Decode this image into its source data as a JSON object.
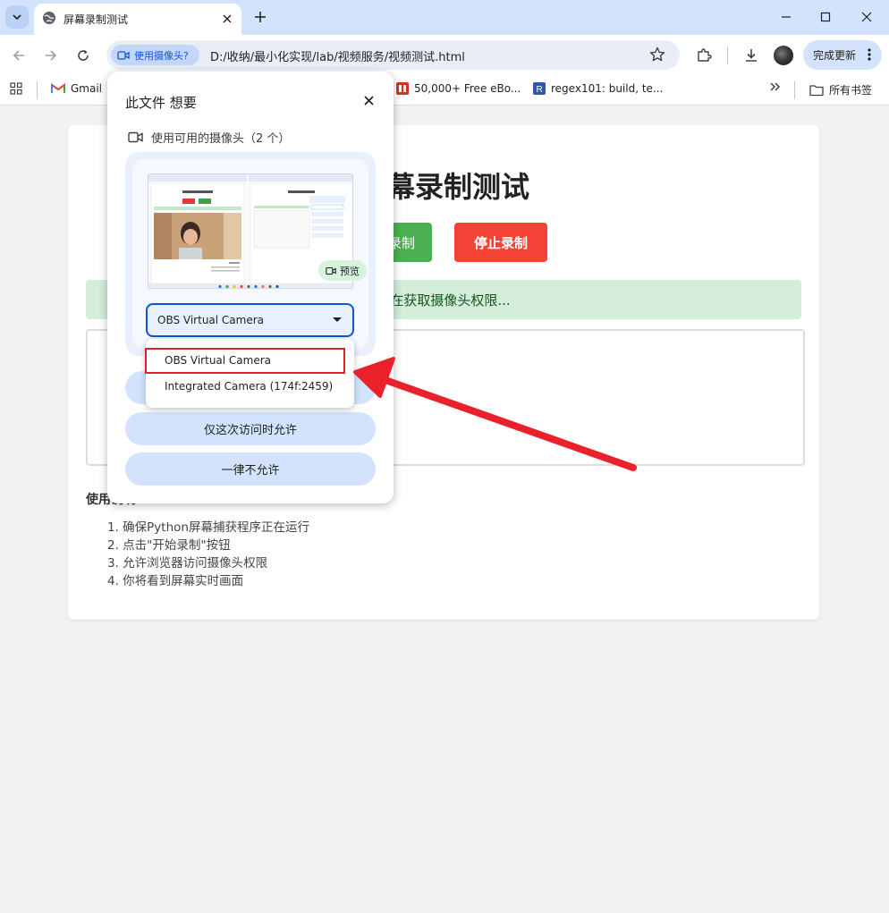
{
  "browser": {
    "tab": {
      "title": "屏幕录制测试"
    },
    "address": {
      "chip_label": "使用摄像头?",
      "url": "D:/收纳/最小化实现/lab/视频服务/视频测试.html"
    },
    "update_button": "完成更新",
    "bookmarks": [
      {
        "label": "Gmail"
      },
      {
        "label": "50,000+ Free eBo..."
      },
      {
        "label": "regex101: build, te..."
      }
    ],
    "all_bookmarks": "所有书签"
  },
  "page": {
    "title": "屏幕录制测试",
    "start_button": "开始录制",
    "start_button_visible": "录制",
    "stop_button": "停止录制",
    "status": "正在获取摄像头权限...",
    "status_visible": "在获取摄像头权限...",
    "usage_title": "使用说明",
    "usage_title_visible": "使用",
    "steps": [
      "1. 确保Python屏幕捕获程序正在运行",
      "2. 点击\"开始录制\"按钮",
      "3. 允许浏览器访问摄像头权限",
      "4. 你将看到屏幕实时画面"
    ]
  },
  "permission_popup": {
    "title": "此文件 想要",
    "subtitle": "使用可用的摄像头（2 个）",
    "preview_badge": "预览",
    "selected_camera": "OBS Virtual Camera",
    "options": [
      {
        "label": "OBS Virtual Camera",
        "highlighted": true
      },
      {
        "label": "Integrated Camera (174f:2459)",
        "highlighted": false
      }
    ],
    "buttons": {
      "allow_once": "仅这次访问时允许",
      "never_allow": "一律不允许"
    }
  },
  "colors": {
    "start": "#4caf50",
    "stop": "#f44336",
    "status_bg": "#d4edda",
    "annotation": "#e8212b",
    "chrome_accent": "#0b57d0"
  }
}
